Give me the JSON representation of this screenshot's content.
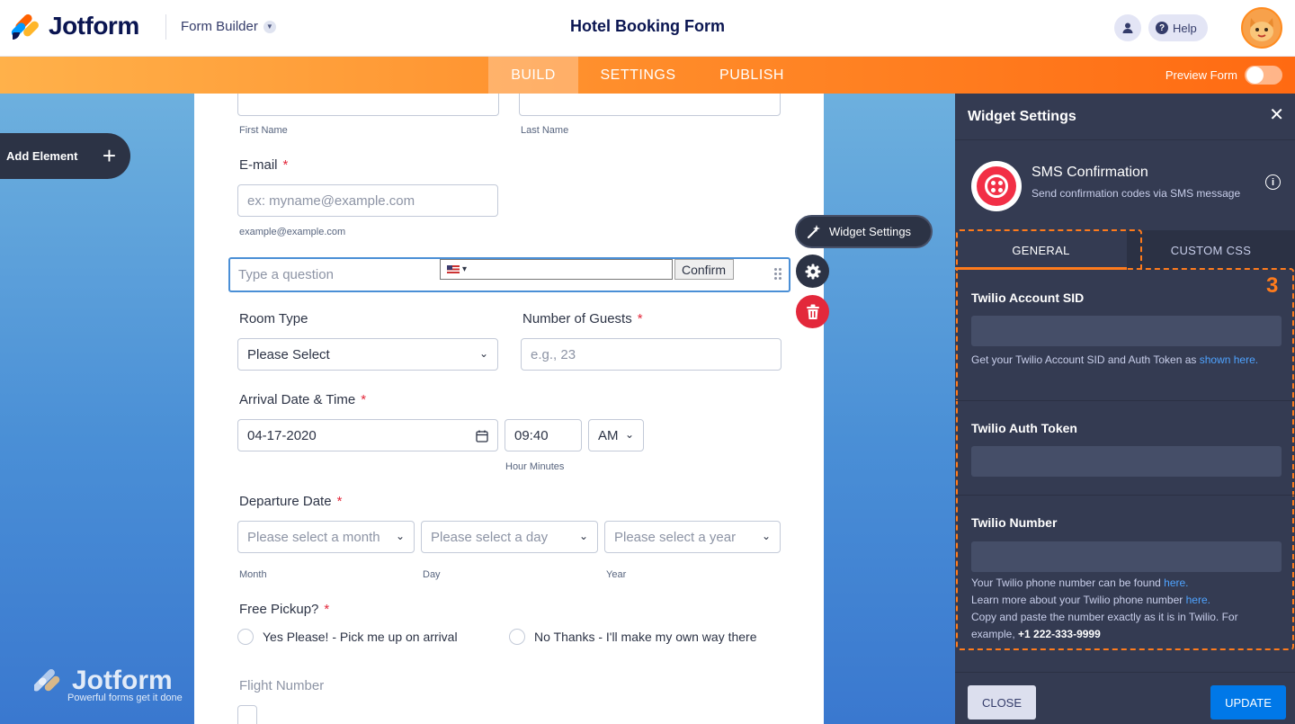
{
  "header": {
    "logo_text": "Jotform",
    "app_menu_label": "Form Builder",
    "form_title": "Hotel Booking Form",
    "help_label": "Help"
  },
  "nav": {
    "tabs": [
      {
        "label": "BUILD",
        "active": true
      },
      {
        "label": "SETTINGS",
        "active": false
      },
      {
        "label": "PUBLISH",
        "active": false
      }
    ],
    "preview_label": "Preview Form",
    "accent_colors": [
      "#ffb14a",
      "#ff6a12"
    ]
  },
  "canvas": {
    "add_element_label": "Add Element",
    "watermark_word": "Jotform",
    "watermark_tagline": "Powerful forms get it done"
  },
  "form": {
    "first_name_sub": "First Name",
    "last_name_sub": "Last Name",
    "email": {
      "label": "E-mail",
      "placeholder": "ex: myname@example.com",
      "sublabel": "example@example.com"
    },
    "question": {
      "placeholder": "Type a question",
      "confirm_label": "Confirm"
    },
    "room_type": {
      "label": "Room Type",
      "value": "Please Select"
    },
    "guests": {
      "label": "Number of Guests",
      "placeholder": "e.g., 23"
    },
    "arrival": {
      "label": "Arrival Date & Time",
      "date": "04-17-2020",
      "time": "09:40",
      "ampm": "AM",
      "time_sub": "Hour Minutes"
    },
    "departure": {
      "label": "Departure Date",
      "month": "Please select a month",
      "day": "Please select a day",
      "year": "Please select a year",
      "month_sub": "Month",
      "day_sub": "Day",
      "year_sub": "Year"
    },
    "pickup": {
      "label": "Free Pickup?",
      "options": [
        "Yes Please! - Pick me up on arrival",
        "No Thanks - I'll make my own way there"
      ]
    },
    "flight_label": "Flight Number"
  },
  "field_tools": {
    "widget_settings_label": "Widget Settings"
  },
  "panel": {
    "title": "Widget Settings",
    "widget_name": "SMS Confirmation",
    "widget_desc": "Send confirmation codes via SMS message",
    "tabs": [
      "GENERAL",
      "CUSTOM CSS"
    ],
    "step_marker": "3",
    "fields": [
      {
        "label": "Twilio Account SID",
        "help_text": "Get your Twilio Account SID and Auth Token as ",
        "help_link": "shown here."
      },
      {
        "label": "Twilio Auth Token"
      },
      {
        "label": "Twilio Number",
        "line1": "Your Twilio phone number can be found ",
        "line1_link": "here.",
        "line2": "Learn more about your Twilio phone number ",
        "line2_link": "here.",
        "line3": "Copy and paste the number exactly as it is in Twilio. For example, ",
        "example": "+1 222-333-9999"
      }
    ],
    "close_label": "CLOSE",
    "update_label": "UPDATE"
  }
}
